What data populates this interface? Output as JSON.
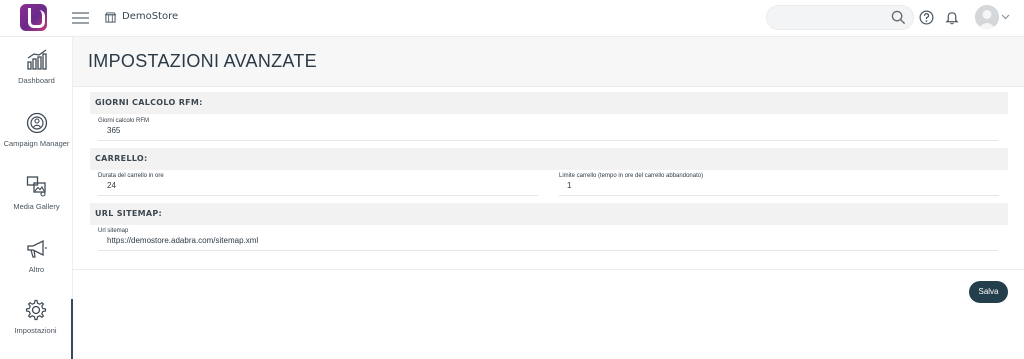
{
  "topbar": {
    "store_name": "DemoStore",
    "search": {
      "value": "",
      "placeholder": ""
    }
  },
  "sidebar": {
    "items": [
      {
        "label": "Dashboard",
        "icon": "bar-chart-icon"
      },
      {
        "label": "Campaign Manager",
        "icon": "target-icon"
      },
      {
        "label": "Media Gallery",
        "icon": "media-gallery-icon"
      },
      {
        "label": "Altro",
        "icon": "megaphone-icon"
      },
      {
        "label": "Impostazioni",
        "icon": "gear-icon",
        "active": true
      }
    ]
  },
  "main": {
    "title": "IMPOSTAZIONI AVANZATE",
    "sections": [
      {
        "heading": "GIORNI CALCOLO RFM:",
        "fields": [
          {
            "label": "Giorni calcolo RFM",
            "value": "365"
          }
        ]
      },
      {
        "heading": "CARRELLO:",
        "fields": [
          {
            "label": "Durata del carrello in ore",
            "value": "24"
          },
          {
            "label": "Limite carrello (tempo in ore del carrello abbandonato)",
            "value": "1"
          }
        ]
      },
      {
        "heading": "URL SITEMAP:",
        "fields": [
          {
            "label": "Url sitemap",
            "value": "https://demostore.adabra.com/sitemap.xml"
          }
        ]
      }
    ],
    "save_label": "Salva"
  },
  "colors": {
    "primary_button": "#253e4b",
    "section_bg": "#f2f2f2",
    "logo_purple": "#7a2c8d"
  }
}
